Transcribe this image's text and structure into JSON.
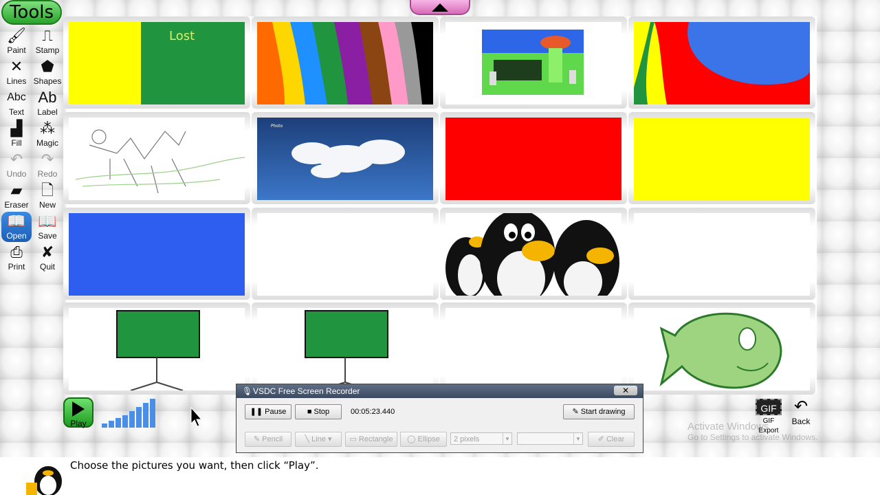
{
  "app": {
    "tools_title": "Tools",
    "tools": [
      {
        "label": "Paint",
        "icon": "paintbrush-icon",
        "glyph": "🖌"
      },
      {
        "label": "Stamp",
        "icon": "stamp-icon",
        "glyph": "⎍"
      },
      {
        "label": "Lines",
        "icon": "lines-icon",
        "glyph": "✕"
      },
      {
        "label": "Shapes",
        "icon": "pentagon-icon",
        "glyph": "⬟"
      },
      {
        "label": "Text",
        "icon": "text-icon",
        "glyph": "Abc"
      },
      {
        "label": "Label",
        "icon": "label-icon",
        "glyph": "Ab"
      },
      {
        "label": "Fill",
        "icon": "fill-bucket-icon",
        "glyph": "▟"
      },
      {
        "label": "Magic",
        "icon": "magic-wand-icon",
        "glyph": "⁂"
      },
      {
        "label": "Undo",
        "icon": "undo-icon",
        "glyph": "↶"
      },
      {
        "label": "Redo",
        "icon": "redo-icon",
        "glyph": "↷"
      },
      {
        "label": "Eraser",
        "icon": "eraser-icon",
        "glyph": "▰"
      },
      {
        "label": "New",
        "icon": "new-document-icon",
        "glyph": "🗋"
      },
      {
        "label": "Open",
        "icon": "open-book-icon",
        "glyph": "📖"
      },
      {
        "label": "Save",
        "icon": "save-book-icon",
        "glyph": "📖"
      },
      {
        "label": "Print",
        "icon": "printer-icon",
        "glyph": "⎙"
      },
      {
        "label": "Quit",
        "icon": "quit-x-icon",
        "glyph": "✘"
      }
    ],
    "play_label": "Play",
    "gif_export_label": "GIF Export",
    "gif_badge": "GIF",
    "back_label": "Back",
    "status_text": "Choose the pictures you want, then click “Play”.",
    "thumb_text_lost": "Lost",
    "thumb_text_sky": "Photo",
    "watermark_line1": "Activate Windows",
    "watermark_line2": "Go to Settings to activate Windows."
  },
  "recorder": {
    "title": "VSDC Free Screen Recorder",
    "close": "✕",
    "pause": "Pause",
    "stop": "Stop",
    "time": "00:05:23.440",
    "start_drawing": "Start drawing",
    "pencil": "Pencil",
    "line": "Line",
    "rectangle": "Rectangle",
    "ellipse": "Ellipse",
    "thickness": "2 pixels",
    "clear": "Clear"
  },
  "colors": {
    "yellow": "#ffff00",
    "green": "#21943f",
    "red": "#ff0000",
    "blue": "#2e5ef0",
    "accent_tools": "#2aa42a",
    "accent_scroll": "#d86ab8"
  }
}
